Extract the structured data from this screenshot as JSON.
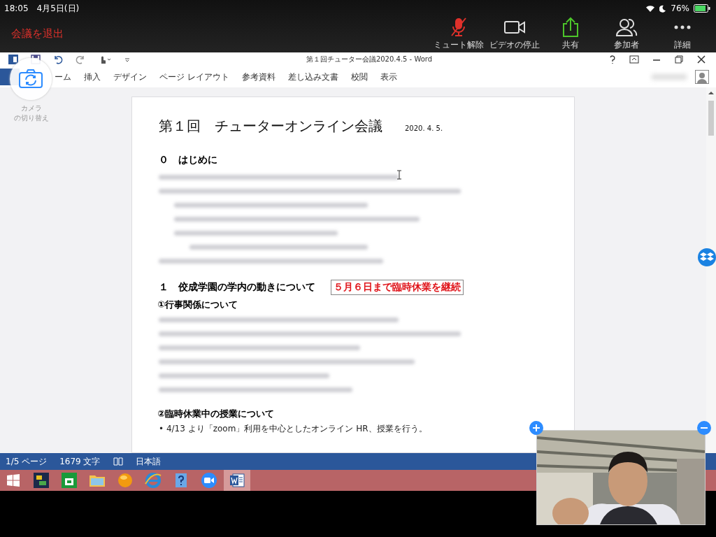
{
  "status_bar": {
    "time": "18:05",
    "date": "4月5日(日)",
    "battery": "76%"
  },
  "meeting_bar": {
    "leave": "会議を退出",
    "controls": [
      {
        "kind": "mic",
        "label": "ミュート解除",
        "muted": true
      },
      {
        "kind": "video",
        "label": "ビデオの停止"
      },
      {
        "kind": "share",
        "label": "共有"
      },
      {
        "kind": "participants",
        "label": "参加者"
      },
      {
        "kind": "more",
        "label": "詳細"
      }
    ]
  },
  "camera_switch": {
    "lines": [
      "カメラ",
      "の切り替え"
    ]
  },
  "word": {
    "title": "第１回チューター会議2020.4.5 - Word",
    "ribbon_tabs": [
      "ーム",
      "挿入",
      "デザイン",
      "ページ レイアウト",
      "参考資料",
      "差し込み文書",
      "校閲",
      "表示"
    ],
    "document": [
      {
        "kind": "title",
        "text": "第１回　チューターオンライン会議",
        "date": "2020. 4. 5."
      },
      {
        "kind": "blank"
      },
      {
        "kind": "heading",
        "text": "０　はじめに"
      },
      {
        "kind": "blurred",
        "lines": [
          {
            "kind": "line"
          },
          {
            "kind": "line",
            "children": [
              {
                "kind": "line"
              },
              {
                "kind": "line"
              },
              {
                "kind": "line",
                "children": [
                  {
                    "kind": "line"
                  }
                ]
              }
            ]
          },
          {
            "kind": "line"
          }
        ]
      },
      {
        "kind": "blank"
      },
      {
        "kind": "heading",
        "text": "１　佼成学園の学内の動きについて",
        "note": "５月６日まで臨時休業を継続"
      },
      {
        "kind": "subheading",
        "text": "①行事関係について"
      },
      {
        "kind": "blurred",
        "lines": [
          {
            "kind": "line"
          },
          {
            "kind": "line"
          },
          {
            "kind": "line"
          },
          {
            "kind": "line"
          },
          {
            "kind": "line"
          },
          {
            "kind": "line"
          }
        ]
      },
      {
        "kind": "blank"
      },
      {
        "kind": "subheading",
        "text": "②臨時休業中の授業について"
      },
      {
        "kind": "bullet",
        "marker": "•",
        "text": "4/13 より「zoom」利用を中心としたオンライン HR、授業を行う。"
      }
    ],
    "status": {
      "page": "1/5 ページ",
      "words": "1679 文字",
      "language": "日本語"
    }
  },
  "taskbar": [
    {
      "kind": "start",
      "selected": false
    },
    {
      "kind": "app",
      "selected": false
    },
    {
      "kind": "store",
      "selected": false
    },
    {
      "kind": "folder",
      "selected": false
    },
    {
      "kind": "ball",
      "selected": false
    },
    {
      "kind": "browser",
      "selected": false
    },
    {
      "kind": "help",
      "selected": false
    },
    {
      "kind": "zoom",
      "selected": false
    },
    {
      "kind": "word",
      "selected": true
    }
  ]
}
